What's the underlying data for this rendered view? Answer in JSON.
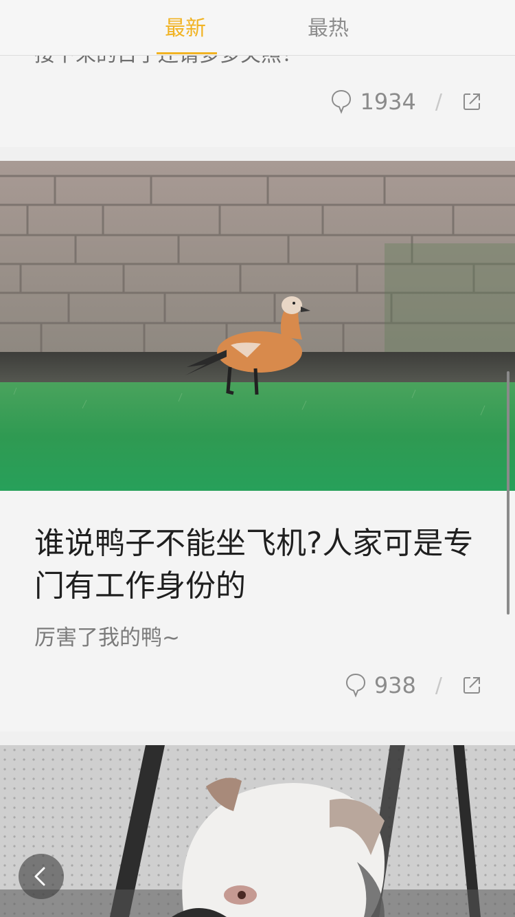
{
  "tabs": {
    "latest": "最新",
    "hot": "最热",
    "active": "latest",
    "active_color": "#f1b323",
    "inactive_color": "#8d8d8d"
  },
  "posts": [
    {
      "excerpt": "接下来的日子还请多多关照！",
      "comments": "1934",
      "separator": "/",
      "comment_icon": "comment-bubble-icon",
      "share_icon": "share-icon"
    },
    {
      "image": "duck-on-grass-photo",
      "title": "谁说鸭子不能坐飞机?人家可是专门有工作身份的",
      "subtitle": "厉害了我的鸭~",
      "comments": "938",
      "separator": "/",
      "comment_icon": "comment-bubble-icon",
      "share_icon": "share-icon"
    },
    {
      "image": "bulldog-photo"
    }
  ],
  "back_button": {
    "icon": "chevron-left-icon"
  }
}
